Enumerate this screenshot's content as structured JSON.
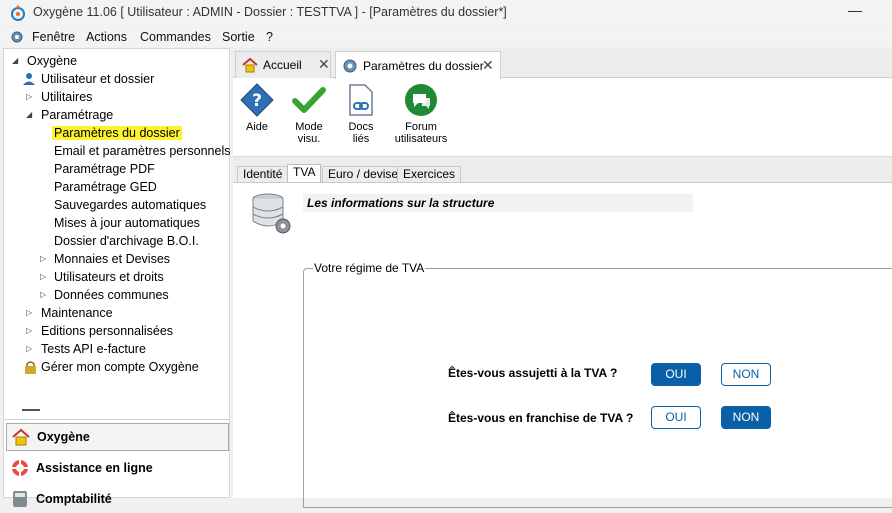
{
  "window": {
    "title": "Oxygène 11.06 [ Utilisateur : ADMIN - Dossier : TESTTVA ] - [Paramètres du dossier*]",
    "minimize_glyph": "—"
  },
  "menu": {
    "items": [
      "Fenêtre",
      "Actions",
      "Commandes",
      "Sortie",
      "?"
    ]
  },
  "tree": {
    "root": "Oxygène",
    "items": [
      {
        "label": "Utilisateur et dossier"
      },
      {
        "label": "Utilitaires"
      },
      {
        "label": "Paramétrage"
      },
      {
        "label": "Paramètres du dossier"
      },
      {
        "label": "Email et paramètres personnels"
      },
      {
        "label": "Paramétrage PDF"
      },
      {
        "label": "Paramétrage GED"
      },
      {
        "label": "Sauvegardes automatiques"
      },
      {
        "label": "Mises à jour automatiques"
      },
      {
        "label": "Dossier d'archivage B.O.I."
      },
      {
        "label": "Monnaies et Devises"
      },
      {
        "label": "Utilisateurs et droits"
      },
      {
        "label": "Données communes"
      },
      {
        "label": "Maintenance"
      },
      {
        "label": "Editions personnalisées"
      },
      {
        "label": "Tests API e-facture"
      },
      {
        "label": "Gérer mon compte Oxygène"
      }
    ]
  },
  "panels": [
    "Oxygène",
    "Assistance en ligne",
    "Comptabilité"
  ],
  "doc_tabs": [
    "Accueil",
    "Paramètres du dossier"
  ],
  "toolbar": {
    "aide": "Aide",
    "mode_1": "Mode",
    "mode_2": "visu.",
    "docs_1": "Docs",
    "docs_2": "liés",
    "forum_1": "Forum",
    "forum_2": "utilisateurs"
  },
  "subtabs": [
    "Identité",
    "TVA",
    "Euro / devise",
    "Exercices"
  ],
  "tva": {
    "info_title": "Les informations sur la structure",
    "legend": "Votre régime de TVA",
    "q1": "Êtes-vous assujetti à la TVA ?",
    "q2": "Êtes-vous en franchise de TVA ?",
    "oui": "OUI",
    "non": "NON",
    "q1_answer": "OUI",
    "q2_answer": "NON"
  },
  "colors": {
    "accent": "#0a60a8",
    "highlight": "#fff230",
    "check_green": "#3aa335",
    "forum_green": "#1e8a35"
  }
}
